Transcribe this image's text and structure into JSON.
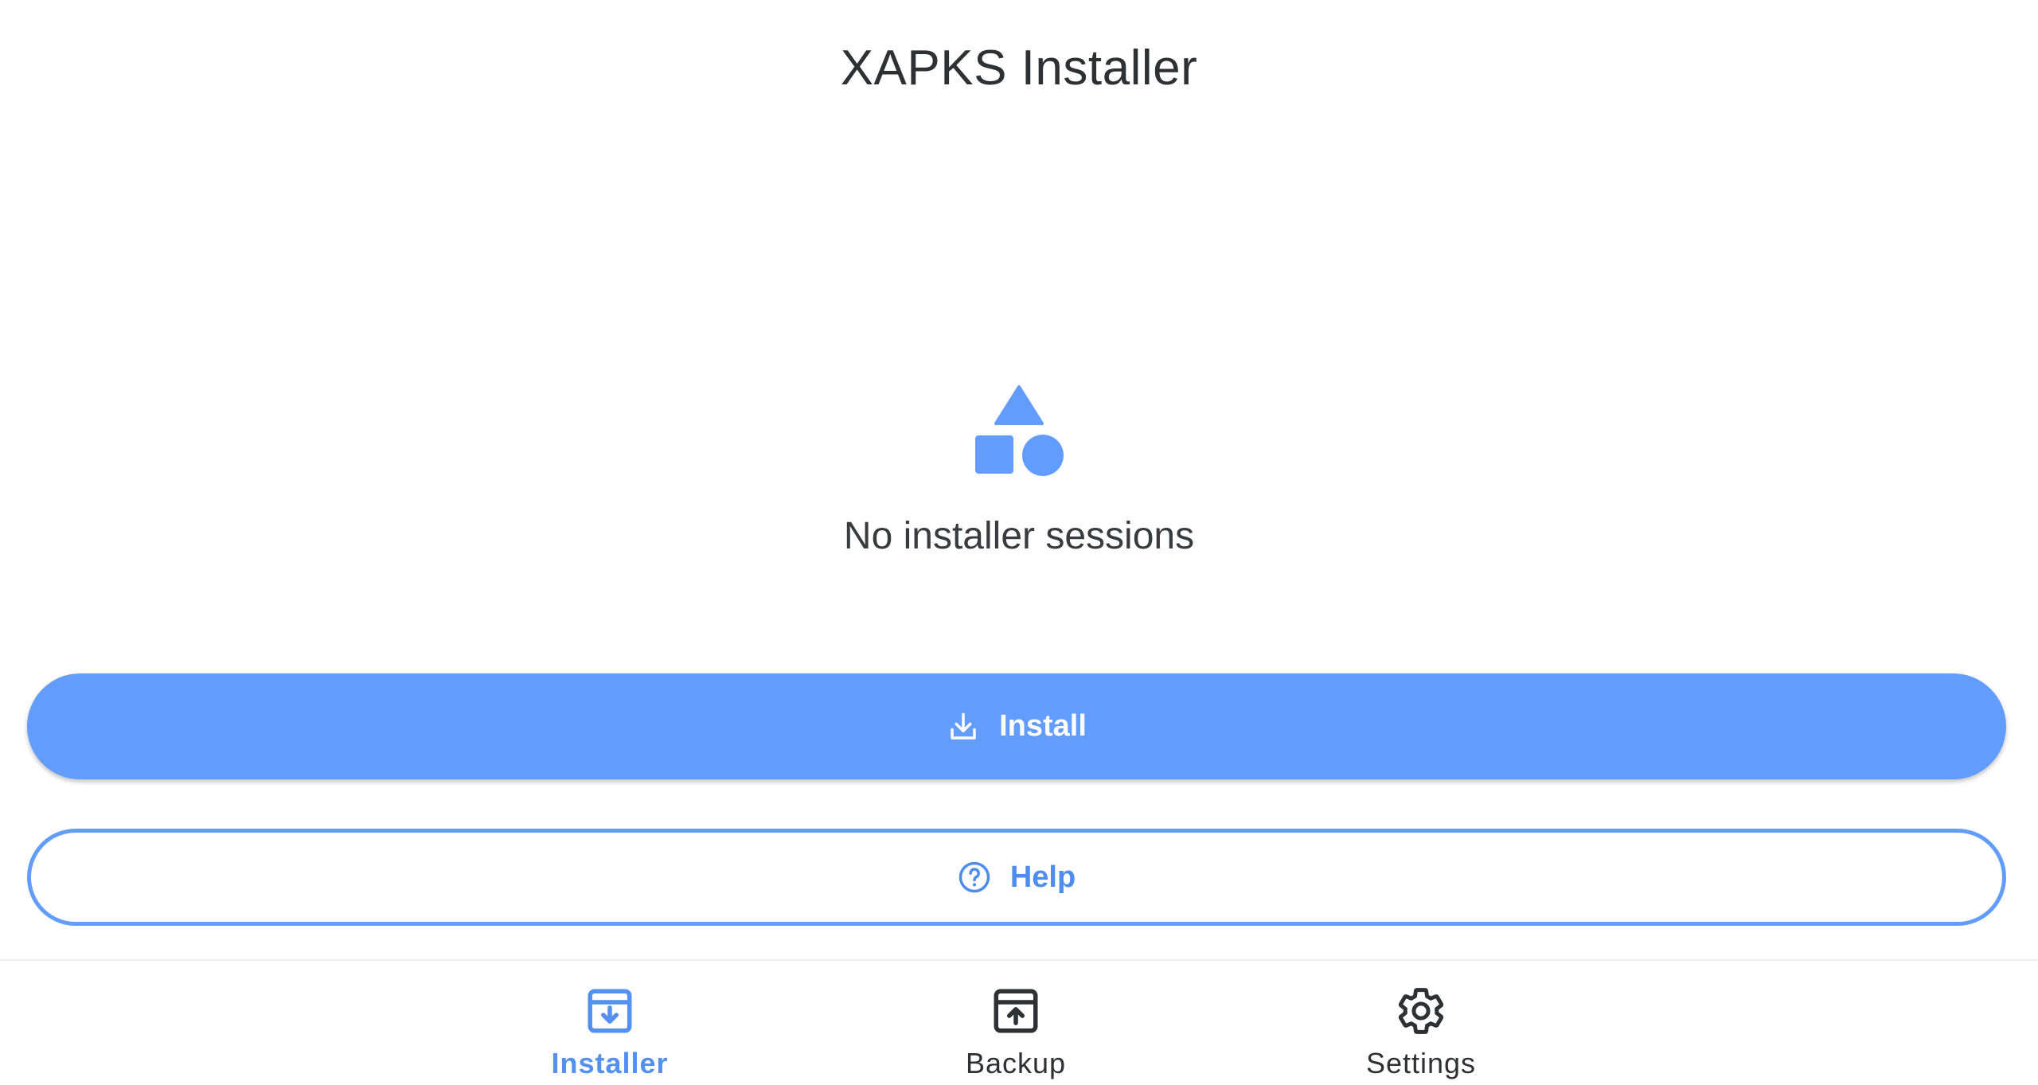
{
  "app": {
    "title": "XAPKS Installer"
  },
  "empty_state": {
    "icon": "shapes-icon",
    "message": "No installer sessions"
  },
  "actions": {
    "install": {
      "label": "Install",
      "icon": "download-icon"
    },
    "help": {
      "label": "Help",
      "icon": "help-circle-icon"
    }
  },
  "bottom_nav": {
    "items": [
      {
        "label": "Installer",
        "icon": "archive-download-icon",
        "active": true
      },
      {
        "label": "Backup",
        "icon": "archive-upload-icon",
        "active": false
      },
      {
        "label": "Settings",
        "icon": "gear-icon",
        "active": false
      }
    ]
  },
  "colors": {
    "accent": "#629cfd",
    "accent_text": "#5490ef",
    "text_primary": "#2f3033",
    "background": "#ffffff"
  }
}
